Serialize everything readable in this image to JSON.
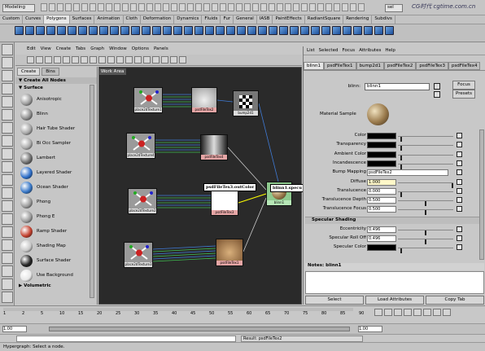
{
  "top_bar": {
    "mode": "Modeling",
    "user_field": "sel"
  },
  "watermark": "CG时代 cgtime.com.cn",
  "shelf_tabs": [
    "Custom",
    "Curves",
    "Polygons",
    "Surfaces",
    "Animation",
    "Cloth",
    "Deformation",
    "Dynamics",
    "Fluids",
    "Fur",
    "General",
    "IASB",
    "PaintEffects",
    "RadiantSquare",
    "Rendering",
    "Subdivs"
  ],
  "shelf_active": "Polygons",
  "hypergraph": {
    "menu": [
      "Edit",
      "View",
      "Create",
      "Tabs",
      "Graph",
      "Window",
      "Options",
      "Panels"
    ],
    "create_tabs": [
      "Create",
      "Bins"
    ],
    "create_all": "Create All Nodes",
    "surface_header": "Surface",
    "nodes": [
      {
        "label": "Anisotropic",
        "color": "#9a9a9a"
      },
      {
        "label": "Blinn",
        "color": "#8d8d8d"
      },
      {
        "label": "Hair Tube Shader",
        "color": "#a5a5a5"
      },
      {
        "label": "Bi Occ Sampler",
        "color": "#aaaaaa"
      },
      {
        "label": "Lambert",
        "color": "#6d6d6d"
      },
      {
        "label": "Layered Shader",
        "color": "#2d6ec9"
      },
      {
        "label": "Ocean Shader",
        "color": "#3777c7"
      },
      {
        "label": "Phong",
        "color": "#9a9a9a"
      },
      {
        "label": "Phong E",
        "color": "#9c9c9c"
      },
      {
        "label": "Ramp Shader",
        "color": "#c3402e"
      },
      {
        "label": "Shading Map",
        "color": "#c9c9c9"
      },
      {
        "label": "Surface Shader",
        "color": "#232323"
      },
      {
        "label": "Use Background",
        "color": "#e8e8e8"
      }
    ],
    "volumetric": "Volumetric",
    "work_area": "Work Area",
    "graph_nodes": {
      "p1": "place2dTexture1",
      "t1": "psdFileTex2",
      "b1": "bump2d1",
      "p2": "place2dTexture4",
      "t2": "psdFileTex4",
      "p3": "place2dTexture2",
      "t3": "psdFileTex3",
      "p4": "place2dTexture3",
      "t4": "psdFileTex1",
      "blinn": "blinn1"
    },
    "tooltip_left": "psdFileTex3.outColor",
    "tooltip_right": "blinn1.specu"
  },
  "attr_editor": {
    "menu": [
      "List",
      "Selected",
      "Focus",
      "Attributes",
      "Help"
    ],
    "tabs": [
      "blinn1",
      "psdFileTex1",
      "bump2d1",
      "psdFileTex2",
      "psdFileTex3",
      "psdFileTex4"
    ],
    "node_label": "blinn:",
    "node_name": "blinn1",
    "focus": "Focus",
    "presets": "Presets",
    "material_sample": "Material Sample",
    "attrs": [
      {
        "label": "Color",
        "type": "swatch",
        "knob": 0.05
      },
      {
        "label": "Transparency",
        "type": "swatch",
        "knob": 0.05
      },
      {
        "label": "Ambient Color",
        "type": "swatch",
        "knob": 0.05
      },
      {
        "label": "Incandescence",
        "type": "swatch",
        "knob": 0.05
      },
      {
        "label": "Bump Mapping",
        "type": "text",
        "value": "psdFileTex2"
      },
      {
        "label": "Diffuse",
        "type": "val",
        "value": "1.000",
        "knob": 1.0,
        "hl": true
      },
      {
        "label": "Translucence",
        "type": "val",
        "value": "0.000",
        "knob": 0.05
      },
      {
        "label": "Translucence Depth",
        "type": "val",
        "value": "0.500",
        "knob": 0.5
      },
      {
        "label": "Translucence Focus",
        "type": "val",
        "value": "0.500",
        "knob": 0.5
      }
    ],
    "specular_header": "Specular Shading",
    "spec_attrs": [
      {
        "label": "Eccentricity",
        "type": "val",
        "value": "0.496",
        "knob": 0.5
      },
      {
        "label": "Specular Roll Off",
        "type": "val",
        "value": "0.496",
        "knob": 0.5
      },
      {
        "label": "Specular Color",
        "type": "swatch",
        "knob": 0.05
      }
    ],
    "notes": "Notes:  blinn1",
    "buttons": [
      "Select",
      "Load Attributes",
      "Copy Tab"
    ]
  },
  "timeline": {
    "ticks": [
      "1",
      "2",
      "5",
      "10",
      "15",
      "20",
      "25",
      "30",
      "35",
      "40",
      "45",
      "50",
      "55",
      "60",
      "65",
      "70",
      "75",
      "80",
      "85",
      "90"
    ]
  },
  "range_values": {
    "start": "1.00",
    "end": "1.00"
  },
  "command_result": "Result: psdFileTex2",
  "help_line": "Hypergraph: Select a node."
}
